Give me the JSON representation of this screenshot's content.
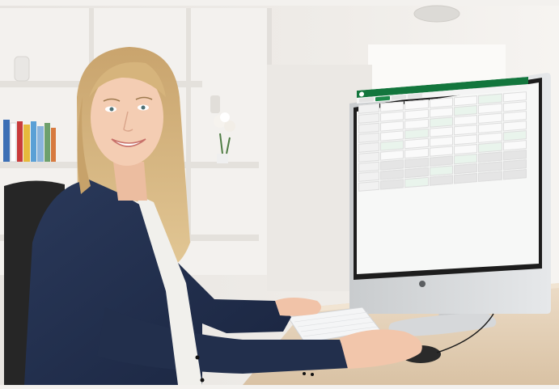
{
  "scene": {
    "description_colors": {
      "wall": "#eeebe7",
      "shelf": "#f4f2ef",
      "desk": "#e6d3bc",
      "jacket": "#1f2d49",
      "hair": "#d3b07a",
      "screen_header": "#13763d",
      "monitor_body": "#d9dcde"
    }
  },
  "screen": {
    "app_header_color": "#13763d",
    "accent": "#1d8a4a",
    "rows": 9,
    "columns": 6
  }
}
